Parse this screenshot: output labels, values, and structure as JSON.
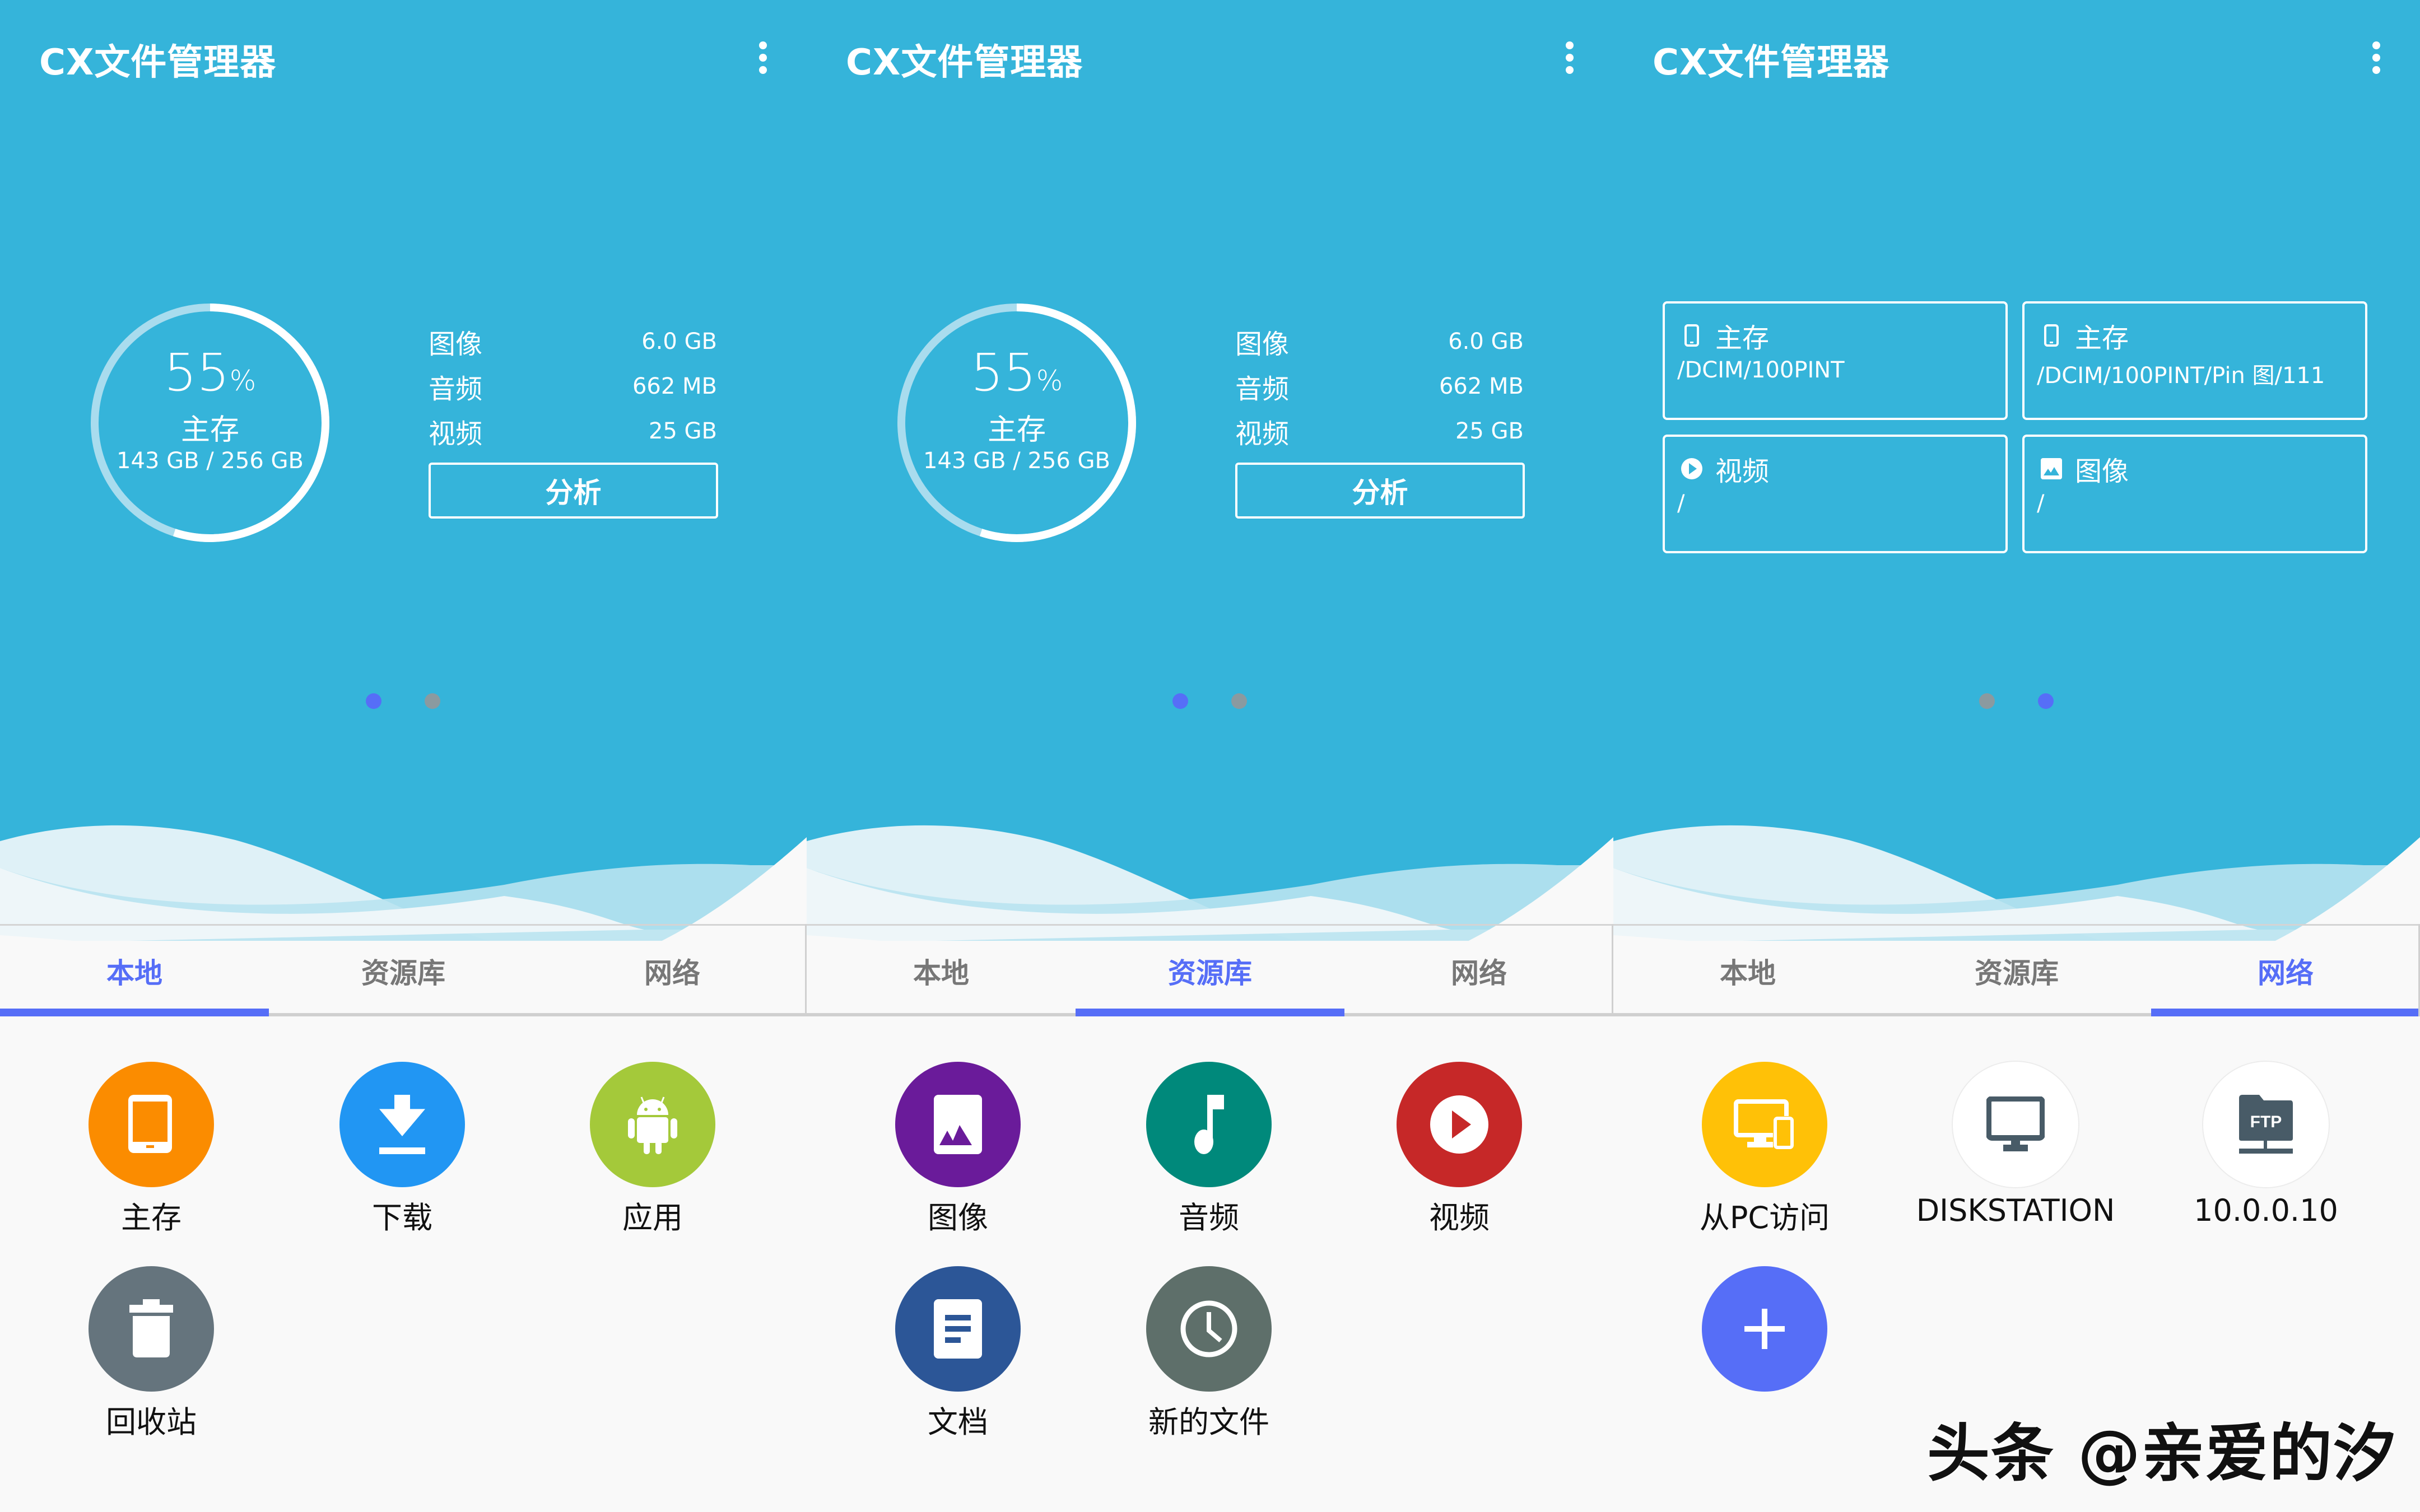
{
  "app": {
    "title": "CX文件管理器",
    "menu_icon": "more-vert-icon"
  },
  "colors": {
    "header_bg": "#35b4da",
    "accent": "#566ef7",
    "tab_inactive": "#777777",
    "dot_active": "#566ef7",
    "dot_inactive": "#8a9aa0",
    "gauge_used": "#ffffff",
    "gauge_free": "#a9dcee"
  },
  "storage": {
    "used_percent": 55,
    "percent_text": "55",
    "percent_sign": "%",
    "name": "主存",
    "usage_text": "143 GB / 256 GB",
    "stats": [
      {
        "label": "图像",
        "value": "6.0 GB"
      },
      {
        "label": "音频",
        "value": "662 MB"
      },
      {
        "label": "视频",
        "value": "25 GB"
      }
    ],
    "analyze_label": "分析"
  },
  "recents": [
    {
      "icon": "phone-icon",
      "title": "主存",
      "path": "/DCIM/100PINT"
    },
    {
      "icon": "phone-icon",
      "title": "主存",
      "path": "/DCIM/100PINT/Pin 图/111"
    },
    {
      "icon": "play-circle-icon",
      "title": "视频",
      "path": "/"
    },
    {
      "icon": "image-icon",
      "title": "图像",
      "path": "/"
    }
  ],
  "tabs": [
    {
      "label": "本地"
    },
    {
      "label": "资源库"
    },
    {
      "label": "网络"
    }
  ],
  "panels": [
    {
      "active_tab": 0,
      "active_page": 0
    },
    {
      "active_tab": 1,
      "active_page": 0
    },
    {
      "active_tab": 2,
      "active_page": 1
    }
  ],
  "local_items": [
    {
      "label": "主存",
      "icon": "smartphone-icon",
      "color": "#fb8c00"
    },
    {
      "label": "下载",
      "icon": "download-icon",
      "color": "#2196f3"
    },
    {
      "label": "应用",
      "icon": "android-icon",
      "color": "#a4c93a"
    },
    {
      "label": "回收站",
      "icon": "trash-icon",
      "color": "#65747d"
    }
  ],
  "library_items": [
    {
      "label": "图像",
      "icon": "image-icon",
      "color": "#6a1b9a"
    },
    {
      "label": "音频",
      "icon": "music-note-icon",
      "color": "#00897b"
    },
    {
      "label": "视频",
      "icon": "play-circle-icon",
      "color": "#c62828"
    },
    {
      "label": "文档",
      "icon": "document-icon",
      "color": "#2c5697"
    },
    {
      "label": "新的文件",
      "icon": "clock-icon",
      "color": "#5e6f6a"
    }
  ],
  "network_items": [
    {
      "label": "从PC访问",
      "icon": "pc-access-icon",
      "color": "#ffc107"
    },
    {
      "label": "DISKSTATION",
      "icon": "monitor-icon",
      "color": "#ffffff"
    },
    {
      "label": "10.0.0.10",
      "icon": "ftp-icon",
      "color": "#ffffff",
      "badge": "FTP"
    },
    {
      "label": "",
      "icon": "add-icon",
      "color": "#566ef7"
    }
  ],
  "watermark": "头条 @亲爱的汐"
}
